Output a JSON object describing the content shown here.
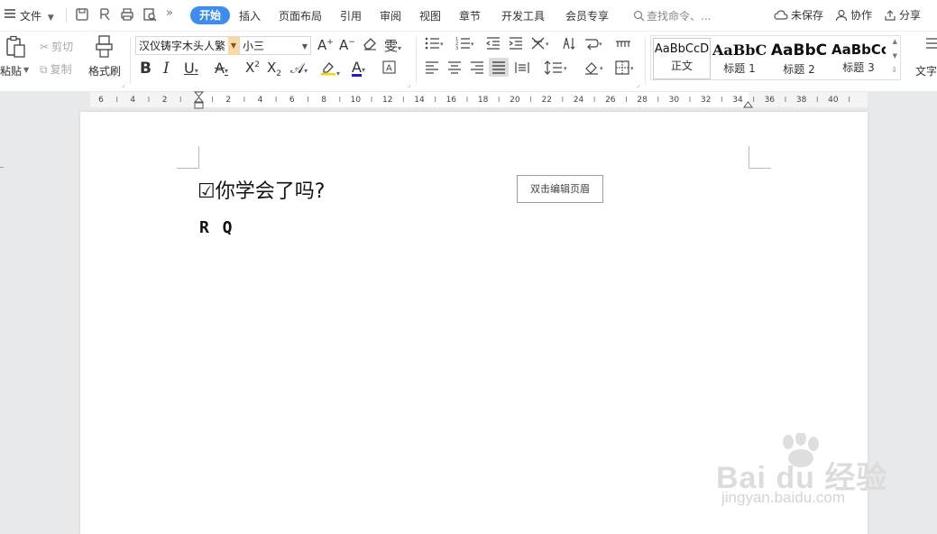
{
  "menu": {
    "file_label": "文件",
    "tabs": [
      {
        "label": "开始",
        "active": true
      },
      {
        "label": "插入"
      },
      {
        "label": "页面布局"
      },
      {
        "label": "引用"
      },
      {
        "label": "审阅"
      },
      {
        "label": "视图"
      },
      {
        "label": "章节"
      },
      {
        "label": "开发工具"
      },
      {
        "label": "会员专享"
      }
    ],
    "search_placeholder": "查找命令、...",
    "unsaved_label": "未保存",
    "collab_label": "协作",
    "share_label": "分享",
    "accent_color": "#3d8cf1"
  },
  "ribbon": {
    "paste_label": "粘贴",
    "cut_label": "剪切",
    "copy_label": "复制",
    "format_painter_label": "格式刷",
    "font_name": "汉仪铸字木头人繁",
    "font_size": "小三",
    "styles": [
      {
        "sample": "AaBbCcD",
        "name": "正文"
      },
      {
        "sample": "AaBbCc",
        "name": "标题 1"
      },
      {
        "sample": "AaBbC",
        "name": "标题 2"
      },
      {
        "sample": "AaBbCc",
        "name": "标题 3"
      }
    ],
    "text_tools_label": "文字"
  },
  "ruler": {
    "labels": [
      "6",
      "4",
      "2",
      "",
      "2",
      "4",
      "6",
      "8",
      "10",
      "12",
      "14",
      "16",
      "18",
      "20",
      "22",
      "24",
      "26",
      "28",
      "30",
      "32",
      "34",
      "36",
      "38",
      "40"
    ]
  },
  "document": {
    "title": "☑你学会了吗?",
    "line2": "R Q",
    "header_hint": "双击编辑页眉"
  },
  "watermark": {
    "text": "Bai du 经验",
    "sub": "jingyan.baidu.com"
  }
}
